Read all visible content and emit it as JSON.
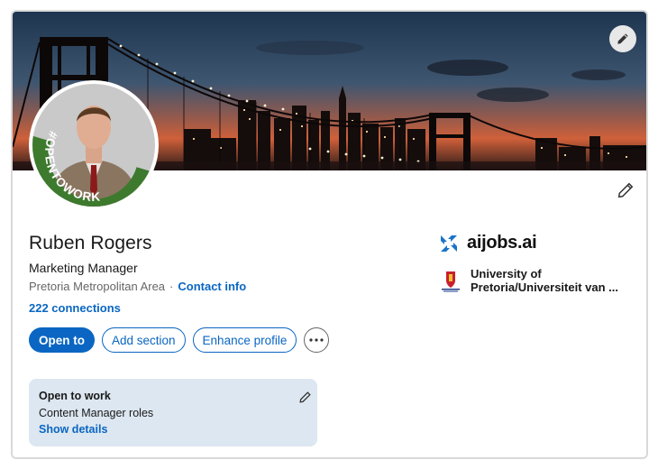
{
  "profile": {
    "name": "Ruben Rogers",
    "headline": "Marketing Manager",
    "location": "Pretoria Metropolitan Area",
    "separator": "·",
    "contact_info": "Contact info",
    "connections": "222 connections",
    "frame_badge": "#OPENTOWORK"
  },
  "actions": {
    "open_to": "Open to",
    "add_section": "Add section",
    "enhance_profile": "Enhance profile"
  },
  "open_to_work": {
    "title": "Open to work",
    "roles": "Content Manager roles",
    "show_details": "Show details"
  },
  "organizations": [
    {
      "name": "aijobs.ai",
      "logo": "aijobs-logo-icon"
    },
    {
      "name_line1": "University of",
      "name_line2": "Pretoria/Universiteit van ...",
      "logo": "university-crest-icon"
    }
  ],
  "colors": {
    "accent": "#0a66c2",
    "otw_green": "#3d7a2e",
    "card_bg": "#dde7f1"
  },
  "icons": {
    "cover_edit": "pencil-icon",
    "profile_edit": "pencil-icon",
    "more": "ellipsis-icon"
  }
}
